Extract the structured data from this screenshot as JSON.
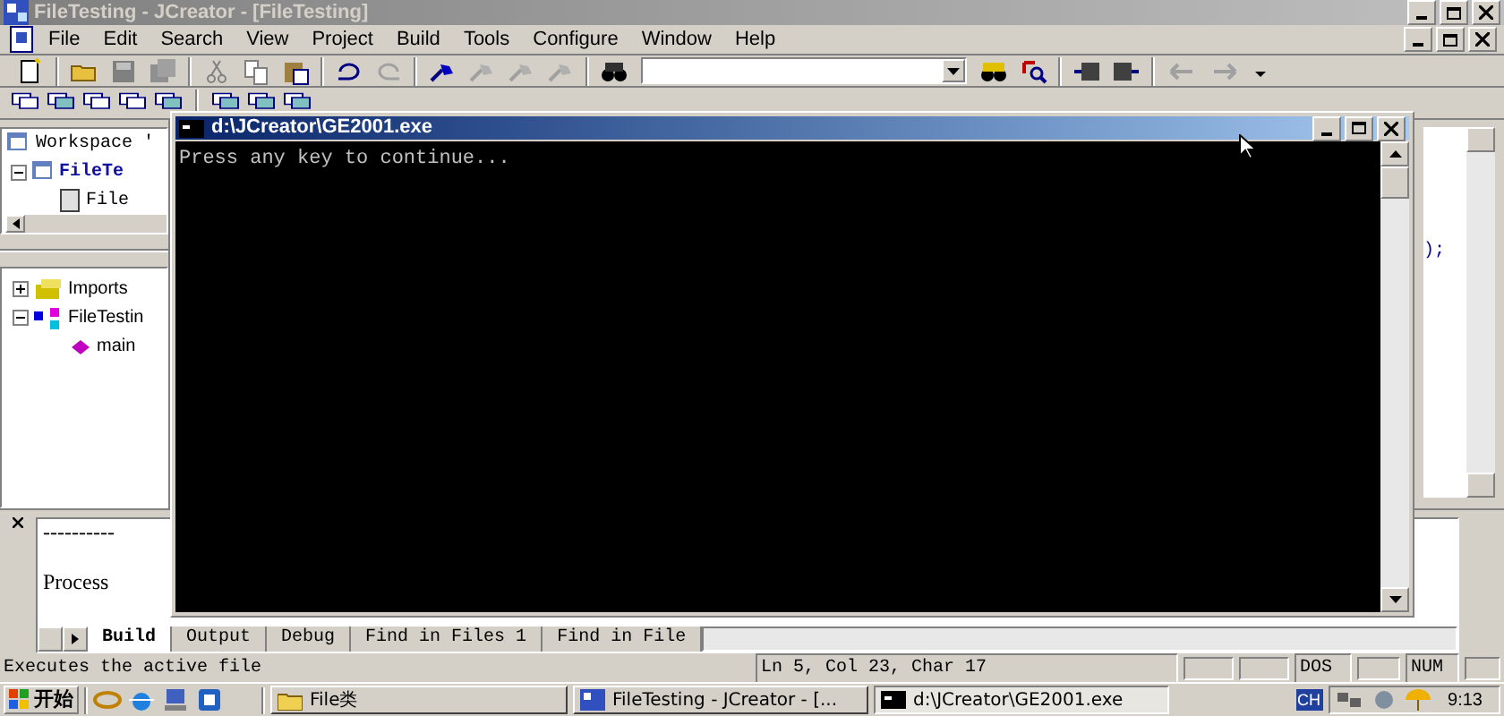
{
  "window": {
    "title": "FileTesting - JCreator - [FileTesting]"
  },
  "menu": [
    "File",
    "Edit",
    "Search",
    "View",
    "Project",
    "Build",
    "Tools",
    "Configure",
    "Window",
    "Help"
  ],
  "workspace": {
    "root": "Workspace '",
    "projects": [
      {
        "label": "FileTe",
        "active": true,
        "expanded": true,
        "children": [
          {
            "label": "File"
          }
        ]
      }
    ]
  },
  "classes": [
    {
      "label": "Imports",
      "expanded": false
    },
    {
      "label": "FileTestin",
      "expanded": true,
      "children": [
        {
          "label": "main"
        }
      ]
    }
  ],
  "editor": {
    "line": ");"
  },
  "output": {
    "lines": [
      "----------",
      "Process"
    ],
    "tabs": [
      {
        "label": "Build",
        "selected": true
      },
      {
        "label": "Output",
        "selected": false
      },
      {
        "label": "Debug",
        "selected": false
      },
      {
        "label": "Find in Files 1",
        "selected": false
      },
      {
        "label": "Find in File",
        "selected": false
      }
    ]
  },
  "console": {
    "title": "d:\\JCreator\\GE2001.exe",
    "text": "Press any key to continue..."
  },
  "status_bar": {
    "message": "Executes the active file",
    "position": "Ln 5, Col 23, Char 17",
    "mode": "DOS",
    "num": "NUM"
  },
  "taskbar": {
    "start": "开始",
    "buttons": [
      {
        "label": "File类",
        "kind": "folder",
        "selected": false
      },
      {
        "label": "FileTesting - JCreator - [...",
        "kind": "ide",
        "selected": false
      },
      {
        "label": "d:\\JCreator\\GE2001.exe",
        "kind": "console",
        "selected": true
      }
    ],
    "ime": "CH",
    "clock": "9:13"
  }
}
